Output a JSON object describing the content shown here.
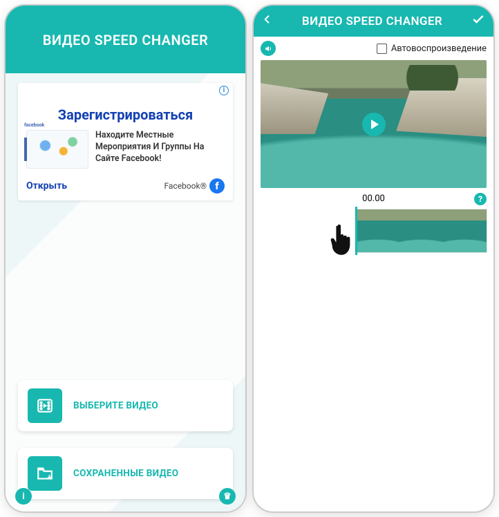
{
  "left": {
    "header_title": "ВИДЕО SPEED CHANGER",
    "ad": {
      "title": "Зарегистрироваться",
      "fb_tag": "facebook",
      "text": "Находите Местные Мероприятия И Группы На Сайте Facebook!",
      "open_label": "Открыть",
      "brand_label": "Facebook®"
    },
    "buttons": {
      "select_video": "ВЫБЕРИТЕ ВИДЕО",
      "saved_videos": "СОХРАНЕННЫЕ ВИДЕО"
    },
    "info_glyph": "i",
    "crown_glyph": "♛"
  },
  "right": {
    "header_title": "ВИДЕО SPEED CHANGER",
    "autoplay_label": "Автовоспроизведение",
    "time_label": "00.00",
    "help_glyph": "?"
  },
  "colors": {
    "accent": "#18b8b0"
  }
}
